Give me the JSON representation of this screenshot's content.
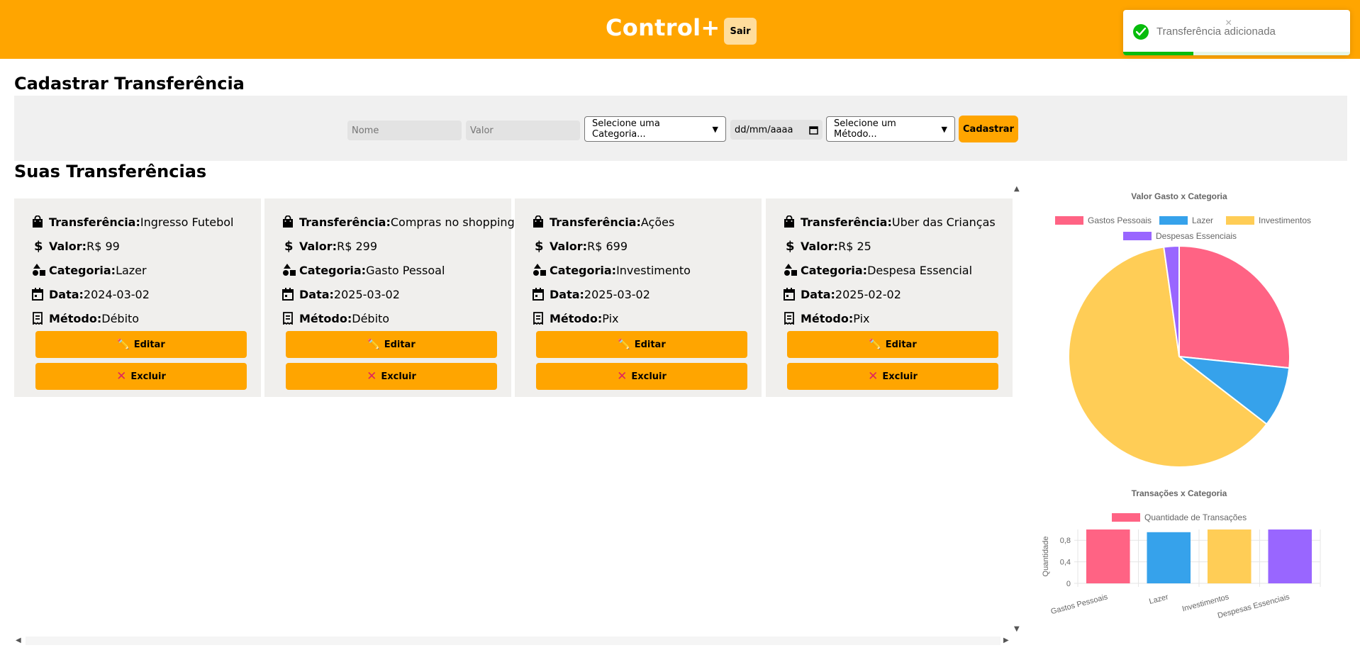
{
  "header": {
    "brand": "Control+",
    "logout_label": "Sair"
  },
  "toast": {
    "message": "Transferência adicionada",
    "close_glyph": "×",
    "progress": 0.31,
    "color": "#07bc0c"
  },
  "form": {
    "title": "Cadastrar Transferência",
    "name_placeholder": "Nome",
    "value_placeholder": "Valor",
    "category_selected": "Selecione uma Categoria...",
    "date_placeholder": "dd/mm/aaaa",
    "method_selected": "Selecione um Método...",
    "submit_label": "Cadastrar"
  },
  "list": {
    "title": "Suas Transferências",
    "field_labels": {
      "transfer": "Transferência:",
      "value": "Valor:",
      "category": "Categoria:",
      "date": "Data:",
      "method": "Método:"
    },
    "edit_label": "Editar",
    "delete_label": "Excluir",
    "cards": [
      {
        "name": "Ingresso Futebol",
        "value": "R$ 99",
        "category": "Lazer",
        "date": "2024-03-02",
        "method": "Débito"
      },
      {
        "name": "Compras no shopping",
        "value": "R$ 299",
        "category": "Gasto Pessoal",
        "date": "2025-03-02",
        "method": "Débito"
      },
      {
        "name": "Ações",
        "value": "R$ 699",
        "category": "Investimento",
        "date": "2025-03-02",
        "method": "Pix"
      },
      {
        "name": "Uber das Crianças",
        "value": "R$ 25",
        "category": "Despesa Essencial",
        "date": "2025-02-02",
        "method": "Pix"
      }
    ]
  },
  "colors": {
    "brand": "#ffa500",
    "gastos_pessoais": "#ff6384",
    "lazer": "#36a2eb",
    "investimentos": "#ffcd56",
    "despesas_essenciais": "#9966ff"
  },
  "chart_data": [
    {
      "type": "pie",
      "title": "Valor Gasto x Categoria",
      "legend_position": "top",
      "categories": [
        "Gastos Pessoais",
        "Lazer",
        "Investimentos",
        "Despesas Essenciais"
      ],
      "values": [
        299,
        99,
        699,
        25
      ],
      "colors": [
        "#ff6384",
        "#36a2eb",
        "#ffcd56",
        "#9966ff"
      ]
    },
    {
      "type": "bar",
      "title": "Transações x Categoria",
      "legend_position": "top",
      "categories": [
        "Gastos Pessoais",
        "Lazer",
        "Investimentos",
        "Despesas Essenciais"
      ],
      "series": [
        {
          "name": "Quantidade de Transações",
          "values": [
            1,
            0.95,
            1,
            1
          ]
        }
      ],
      "colors": [
        "#ff6384",
        "#36a2eb",
        "#ffcd56",
        "#9966ff"
      ],
      "ylabel": "Quantidade",
      "yticks": [
        "0",
        "0,4",
        "0,8"
      ],
      "ylim": [
        0,
        1
      ]
    }
  ]
}
